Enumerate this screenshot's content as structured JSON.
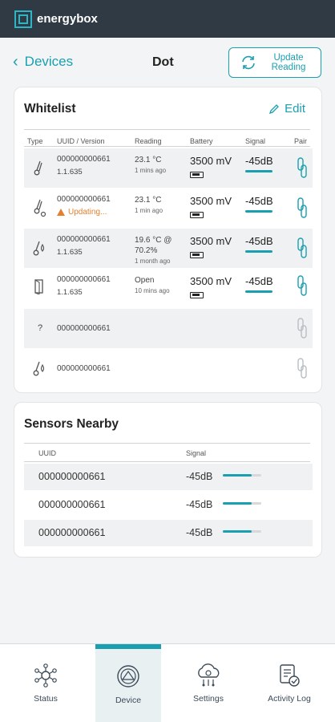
{
  "app": {
    "logo_text": "energybox"
  },
  "nav": {
    "back_label": "Devices",
    "title": "Dot",
    "update_label": "Update Reading"
  },
  "whitelist": {
    "title": "Whitelist",
    "edit_label": "Edit",
    "columns": [
      "Type",
      "UUID / Version",
      "Reading",
      "Battery",
      "Signal",
      "Pair"
    ],
    "rows": [
      {
        "icon": "thermometer-icon",
        "uuid": "000000000661",
        "version": "1.1.635",
        "reading": "23.1 °C",
        "ago": "1 mins ago",
        "battery": "3500 mV",
        "signal": "-45dB",
        "status": ""
      },
      {
        "icon": "thermometer-updating-icon",
        "uuid": "000000000661",
        "version": "",
        "reading": "23.1 °C",
        "ago": "1 min ago",
        "battery": "3500 mV",
        "signal": "-45dB",
        "status": "Updating..."
      },
      {
        "icon": "humidity-icon",
        "uuid": "000000000661",
        "version": "1.1.635",
        "reading": "19.6 °C @ 70.2%",
        "ago": "1 month ago",
        "battery": "3500 mV",
        "signal": "-45dB",
        "status": ""
      },
      {
        "icon": "door-icon",
        "uuid": "000000000661",
        "version": "1.1.635",
        "reading": "Open",
        "ago": "10 mins ago",
        "battery": "3500 mV",
        "signal": "-45dB",
        "status": ""
      },
      {
        "icon": "unknown-icon",
        "uuid": "000000000661",
        "version": "",
        "reading": "",
        "ago": "",
        "battery": "",
        "signal": "",
        "status": ""
      },
      {
        "icon": "humidity-icon",
        "uuid": "000000000661",
        "version": "",
        "reading": "",
        "ago": "",
        "battery": "",
        "signal": "",
        "status": ""
      }
    ]
  },
  "nearby": {
    "title": "Sensors Nearby",
    "columns": [
      "UUID",
      "Signal"
    ],
    "rows": [
      {
        "uuid": "000000000661",
        "signal": "-45dB",
        "strength": 0.75
      },
      {
        "uuid": "000000000661",
        "signal": "-45dB",
        "strength": 0.75
      },
      {
        "uuid": "000000000661",
        "signal": "-45dB",
        "strength": 0.75
      }
    ]
  },
  "tabs": [
    {
      "label": "Status",
      "icon": "network-icon",
      "active": false
    },
    {
      "label": "Device",
      "icon": "device-icon",
      "active": true
    },
    {
      "label": "Settings",
      "icon": "cloud-settings-icon",
      "active": false
    },
    {
      "label": "Activity Log",
      "icon": "activity-log-icon",
      "active": false
    }
  ],
  "colors": {
    "accent": "#1a9fb0",
    "header": "#2f3a45",
    "warning": "#e57f2c"
  }
}
